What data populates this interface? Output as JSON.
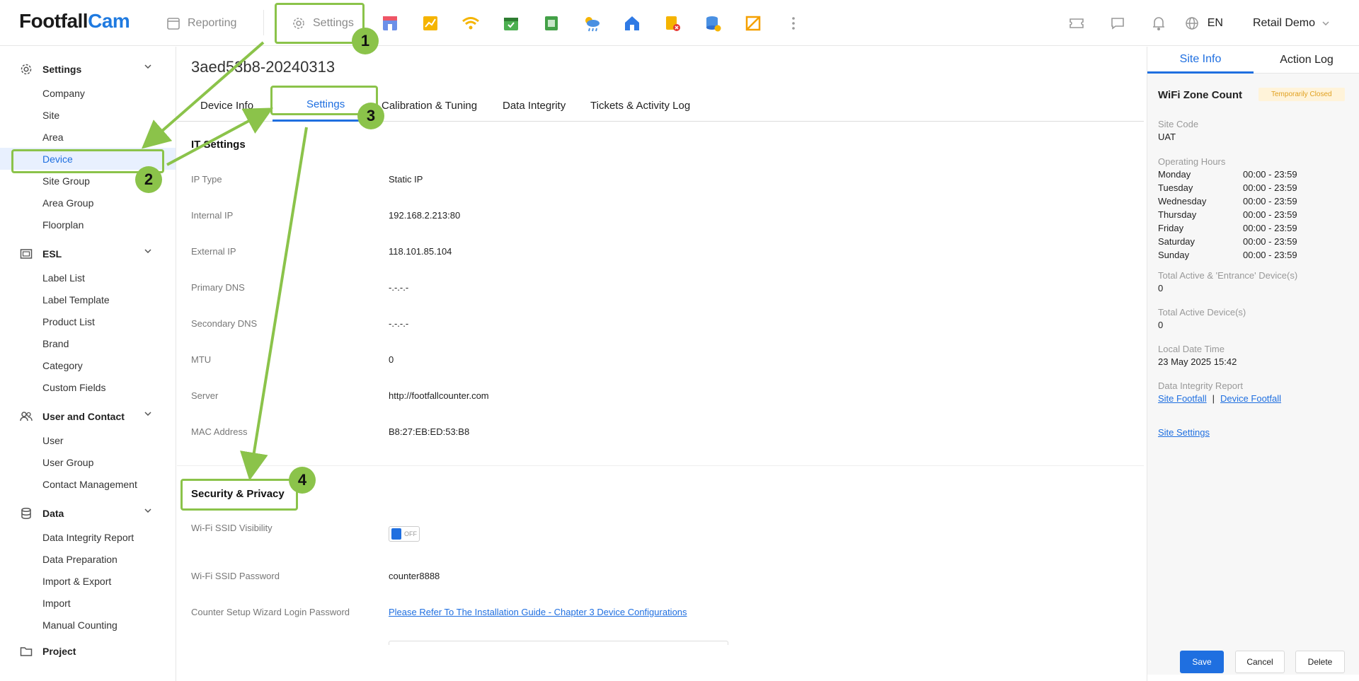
{
  "brand": {
    "part1": "Footfall",
    "part2": "Cam"
  },
  "topnav": {
    "reporting": "Reporting",
    "settings": "Settings"
  },
  "topright": {
    "lang": "EN",
    "user": "Retail Demo"
  },
  "sidebar": {
    "settings": {
      "title": "Settings",
      "items": [
        "Company",
        "Site",
        "Area",
        "Device",
        "Site Group",
        "Area Group",
        "Floorplan"
      ]
    },
    "esl": {
      "title": "ESL",
      "items": [
        "Label List",
        "Label Template",
        "Product List",
        "Brand",
        "Category",
        "Custom Fields"
      ]
    },
    "user": {
      "title": "User and Contact",
      "items": [
        "User",
        "User Group",
        "Contact Management"
      ]
    },
    "data": {
      "title": "Data",
      "items": [
        "Data Integrity Report",
        "Data Preparation",
        "Import & Export",
        "Import",
        "Manual Counting"
      ]
    },
    "project": {
      "title": "Project"
    }
  },
  "main": {
    "device_title": "3aed53b8-20240313",
    "tabs": [
      "Device Info",
      "Settings",
      "Calibration & Tuning",
      "Data Integrity",
      "Tickets & Activity Log"
    ],
    "it_title": "IT Settings",
    "it_rows": [
      {
        "label": "IP Type",
        "value": "Static IP"
      },
      {
        "label": "Internal IP",
        "value": "192.168.2.213:80"
      },
      {
        "label": "External IP",
        "value": "118.101.85.104"
      },
      {
        "label": "Primary DNS",
        "value": "-.-.-.-"
      },
      {
        "label": "Secondary DNS",
        "value": "-.-.-.-"
      },
      {
        "label": "MTU",
        "value": "0"
      },
      {
        "label": "Server",
        "value": "http://footfallcounter.com"
      },
      {
        "label": "MAC Address",
        "value": "B8:27:EB:ED:53:B8"
      }
    ],
    "security_title": "Security & Privacy",
    "ssid_visibility_label": "Wi-Fi SSID Visibility",
    "ssid_toggle_text": "OFF",
    "ssid_password_label": "Wi-Fi SSID Password",
    "ssid_password_value": "counter8888",
    "wizard_label": "Counter Setup Wizard Login Password",
    "wizard_link": "Please Refer To The Installation Guide - Chapter 3 Device Configurations"
  },
  "right_panel": {
    "tabs": [
      "Site Info",
      "Action Log"
    ],
    "title": "WiFi Zone Count",
    "badge": "Temporarily Closed",
    "site_code_label": "Site Code",
    "site_code": "UAT",
    "hours_label": "Operating Hours",
    "hours": [
      {
        "day": "Monday",
        "time": "00:00 - 23:59"
      },
      {
        "day": "Tuesday",
        "time": "00:00 - 23:59"
      },
      {
        "day": "Wednesday",
        "time": "00:00 - 23:59"
      },
      {
        "day": "Thursday",
        "time": "00:00 - 23:59"
      },
      {
        "day": "Friday",
        "time": "00:00 - 23:59"
      },
      {
        "day": "Saturday",
        "time": "00:00 - 23:59"
      },
      {
        "day": "Sunday",
        "time": "00:00 - 23:59"
      }
    ],
    "total_entrance_label": "Total Active & 'Entrance' Device(s)",
    "total_entrance": "0",
    "total_active_label": "Total Active Device(s)",
    "total_active": "0",
    "local_time_label": "Local Date Time",
    "local_time": "23 May 2025 15:42",
    "integrity_label": "Data Integrity Report",
    "integrity_links": [
      "Site Footfall",
      "Device Footfall"
    ],
    "integrity_sep": "|",
    "site_settings": "Site Settings"
  },
  "footer": {
    "save": "Save",
    "cancel": "Cancel",
    "delete": "Delete"
  },
  "annotations": [
    "1",
    "2",
    "3",
    "4"
  ],
  "colors": {
    "accent": "#1f6fe0",
    "annotation": "#8bc34a"
  }
}
